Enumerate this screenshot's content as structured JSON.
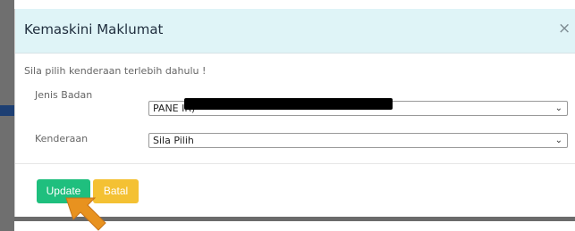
{
  "modal": {
    "title": "Kemaskini Maklumat",
    "close_glyph": "×",
    "notice": "Sila pilih kenderaan terlebih dahulu !",
    "fields": {
      "jenis_badan": {
        "label": "Jenis Badan",
        "value": "PANE                                               IR)"
      },
      "kenderaan": {
        "label": "Kenderaan",
        "value": "Sila Pilih"
      }
    },
    "buttons": {
      "update": "Update",
      "batal": "Batal"
    }
  },
  "colors": {
    "header_bg": "#dff4f7",
    "update_bg": "#1fbf7e",
    "batal_bg": "#f4c133",
    "cursor": "#e8921f"
  },
  "icons": {
    "close": "close-icon",
    "chevron": "chevron-down-icon",
    "pointer": "mouse-pointer-icon"
  }
}
